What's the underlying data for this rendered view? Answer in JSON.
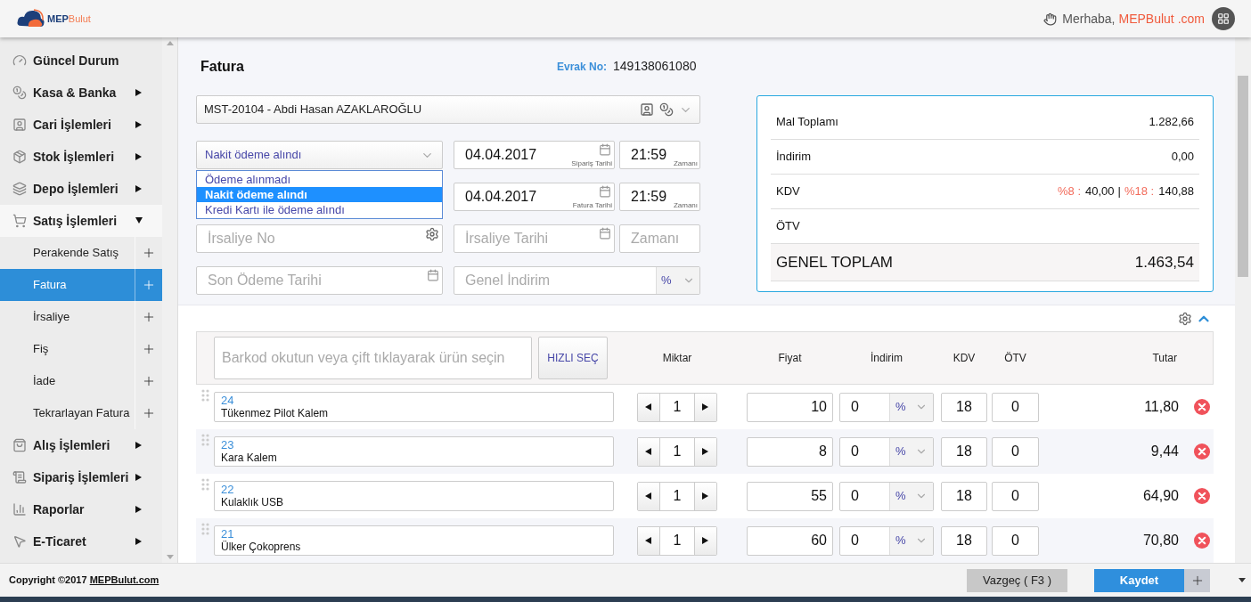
{
  "header": {
    "logo": {
      "first": "MEP",
      "second": "Bulut"
    },
    "greeting": "Merhaba,",
    "user": "MEPBulut .com"
  },
  "sidebar": {
    "items": [
      {
        "label": "Güncel Durum",
        "kind": "link"
      },
      {
        "label": "Kasa & Banka",
        "kind": "menu",
        "expanded": false
      },
      {
        "label": "Cari İşlemleri",
        "kind": "menu",
        "expanded": false
      },
      {
        "label": "Stok İşlemleri",
        "kind": "menu",
        "expanded": false
      },
      {
        "label": "Depo İşlemleri",
        "kind": "menu",
        "expanded": false
      },
      {
        "label": "Satış İşlemleri",
        "kind": "menu",
        "expanded": true,
        "children": [
          {
            "label": "Perakende Satış",
            "selected": false
          },
          {
            "label": "Fatura",
            "selected": true
          },
          {
            "label": "İrsaliye",
            "selected": false
          },
          {
            "label": "Fiş",
            "selected": false
          },
          {
            "label": "İade",
            "selected": false
          },
          {
            "label": "Tekrarlayan Fatura",
            "selected": false
          }
        ]
      },
      {
        "label": "Alış İşlemleri",
        "kind": "menu",
        "expanded": false
      },
      {
        "label": "Sipariş İşlemleri",
        "kind": "menu",
        "expanded": false
      },
      {
        "label": "Raporlar",
        "kind": "menu",
        "expanded": false
      },
      {
        "label": "E-Ticaret",
        "kind": "menu",
        "expanded": false
      }
    ]
  },
  "copyright": {
    "text": "Copyright ©2017",
    "link": "MEPBulut.com"
  },
  "form": {
    "title": "Fatura",
    "doc_no_label": "Evrak No:",
    "doc_no": "149138061080",
    "customer": "MST-20104 - Abdi Hasan AZAKLAROĞLU",
    "payment": {
      "value": "Nakit ödeme alındı",
      "expanded": true,
      "options": [
        {
          "label": "Ödeme alınmadı",
          "selected": false
        },
        {
          "label": "Nakit ödeme alındı",
          "selected": true
        },
        {
          "label": "Kredi Kartı ile ödeme alındı",
          "selected": false
        }
      ]
    },
    "order_date": {
      "value": "04.04.2017",
      "caption": "Sipariş Tarihi",
      "time": "21:59",
      "time_caption": "Zamanı"
    },
    "invoice_date": {
      "value": "04.04.2017",
      "caption": "Fatura Tarihi",
      "time": "21:59",
      "time_caption": "Zamanı"
    },
    "dispatch": {
      "no_placeholder": "İrsaliye No",
      "date_placeholder": "İrsaliye Tarihi",
      "time_placeholder": "Zamanı"
    },
    "due_date": {
      "placeholder": "Son Ödeme Tarihi"
    },
    "general_discount": {
      "placeholder": "Genel İndirim",
      "unit": "%"
    }
  },
  "summary": {
    "rows": [
      {
        "label": "Mal Toplamı",
        "value": "1.282,66"
      },
      {
        "label": "İndirim",
        "value": "0,00"
      },
      {
        "label": "KDV",
        "parts": [
          {
            "rate": "%8 :",
            "amount": "40,00"
          },
          {
            "rate": "%18 :",
            "amount": "140,88"
          }
        ],
        "separator": "|"
      },
      {
        "label": "ÖTV"
      }
    ],
    "grand_total": {
      "label": "GENEL TOPLAM",
      "value": "1.463,54"
    }
  },
  "table": {
    "barcode_placeholder": "Barkod okutun veya çift tıklayarak ürün seçin",
    "quick_select": "HIZLI SEÇ",
    "columns": [
      "Miktar",
      "Fiyat",
      "İndirim",
      "KDV",
      "ÖTV",
      "Tutar"
    ],
    "rows": [
      {
        "code": "24",
        "name": "Tükenmez Pilot Kalem",
        "qty": "1",
        "price": "10",
        "discount": "0",
        "discount_unit": "%",
        "kdv": "18",
        "otv": "0",
        "total": "11,80"
      },
      {
        "code": "23",
        "name": "Kara Kalem",
        "qty": "1",
        "price": "8",
        "discount": "0",
        "discount_unit": "%",
        "kdv": "18",
        "otv": "0",
        "total": "9,44"
      },
      {
        "code": "22",
        "name": "Kulaklık USB",
        "qty": "1",
        "price": "55",
        "discount": "0",
        "discount_unit": "%",
        "kdv": "18",
        "otv": "0",
        "total": "64,90"
      },
      {
        "code": "21",
        "name": "Ülker Çokoprens",
        "qty": "1",
        "price": "60",
        "discount": "0",
        "discount_unit": "%",
        "kdv": "18",
        "otv": "0",
        "total": "70,80"
      }
    ]
  },
  "actions": {
    "cancel": "Vazgeç ( F3 )",
    "save": "Kaydet"
  }
}
